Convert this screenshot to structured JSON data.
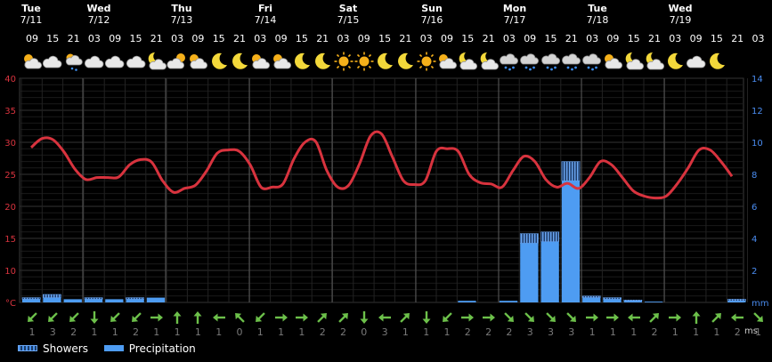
{
  "days": [
    {
      "name": "Tue",
      "date": "7/11"
    },
    {
      "name": "Wed",
      "date": "7/12"
    },
    {
      "name": "Thu",
      "date": "7/13"
    },
    {
      "name": "Fri",
      "date": "7/14"
    },
    {
      "name": "Sat",
      "date": "7/15"
    },
    {
      "name": "Sun",
      "date": "7/16"
    },
    {
      "name": "Mon",
      "date": "7/17"
    },
    {
      "name": "Tue",
      "date": "7/18"
    },
    {
      "name": "Wed",
      "date": "7/19"
    }
  ],
  "hours": [
    "09",
    "15",
    "21",
    "03",
    "09",
    "15",
    "21",
    "03",
    "09",
    "15",
    "21",
    "03",
    "09",
    "15",
    "21",
    "03",
    "09",
    "15",
    "21",
    "03",
    "09",
    "15",
    "21",
    "03",
    "09",
    "15",
    "21",
    "03",
    "09",
    "15",
    "21",
    "03",
    "09",
    "15",
    "21",
    "03",
    "09",
    "15"
  ],
  "icons": [
    "sun-cloud-icon",
    "cloud-icon",
    "cloud-rain-sun-icon",
    "cloud-icon",
    "cloud-icon",
    "cloud-icon",
    "moon-cloud-icon",
    "cloud-sun-icon",
    "sun-cloud-icon",
    "moon-icon",
    "moon-icon",
    "sun-cloud-icon",
    "sun-cloud-icon",
    "moon-icon",
    "moon-icon",
    "sun-icon",
    "sun-icon",
    "moon-icon",
    "moon-icon",
    "sun-icon",
    "sun-cloud-icon",
    "moon-cloud-icon",
    "moon-cloud-icon",
    "cloud-rain-icon",
    "cloud-rain-icon",
    "cloud-rain-icon",
    "cloud-rain-icon",
    "cloud-rain-icon",
    "sun-cloud-icon",
    "moon-cloud-icon",
    "moon-cloud-icon",
    "moon-icon",
    "cloud-icon",
    "moon-icon"
  ],
  "wind": {
    "directions": [
      "sw",
      "sw",
      "sw",
      "s",
      "sw",
      "sw",
      "e",
      "n",
      "n",
      "w",
      "nw",
      "sw",
      "e",
      "e",
      "ne",
      "ne",
      "s",
      "w",
      "ne",
      "s",
      "sw",
      "e",
      "e",
      "se",
      "se",
      "se",
      "se",
      "e",
      "e",
      "w",
      "ne",
      "e",
      "n",
      "ne",
      "w",
      "se"
    ],
    "speeds": [
      "1",
      "3",
      "2",
      "1",
      "1",
      "2",
      "1",
      "1",
      "1",
      "1",
      "0",
      "1",
      "1",
      "1",
      "2",
      "2",
      "0",
      "3",
      "1",
      "1",
      "1",
      "2",
      "2",
      "2",
      "3",
      "3",
      "3",
      "1",
      "1",
      "1",
      "2",
      "1",
      "1",
      "1",
      "2",
      "1"
    ],
    "unit": "ms"
  },
  "legend": {
    "showers": "Showers",
    "precipitation": "Precipitation"
  },
  "colors": {
    "temp_line": "#d8333e",
    "precip": "#4e9cf2",
    "wind_arrow": "#6cc04a",
    "grid": "#2a2a2a",
    "left_axis": "#d8333e",
    "right_axis": "#4a8cf0"
  },
  "chart_data": {
    "type": "line+bar",
    "left_axis": {
      "unit": "°C",
      "ticks": [
        "40",
        "35",
        "30",
        "25",
        "20",
        "15",
        "10",
        "°C"
      ],
      "ylim": [
        5,
        40
      ]
    },
    "right_axis": {
      "unit": "mm",
      "ticks": [
        "14",
        "12",
        "10",
        "8",
        "6",
        "4",
        "2",
        "mm"
      ],
      "ylim": [
        0,
        14
      ]
    },
    "temperature": [
      29.2,
      30.6,
      30.4,
      28.5,
      25.8,
      24.2,
      24.5,
      24.5,
      24.6,
      26.5,
      27.3,
      26.9,
      24.0,
      22.2,
      22.8,
      23.3,
      25.5,
      28.3,
      28.8,
      28.6,
      26.5,
      23.0,
      23.0,
      23.5,
      27.4,
      30.0,
      30.1,
      25.6,
      23.0,
      23.3,
      26.7,
      31.0,
      31.3,
      27.7,
      24.0,
      23.4,
      24.0,
      28.6,
      29.0,
      28.6,
      25.0,
      23.7,
      23.5,
      23.0,
      25.6,
      27.8,
      27.0,
      24.2,
      23.0,
      23.6,
      22.8,
      24.5,
      27.0,
      26.5,
      24.5,
      22.4,
      21.6,
      21.3,
      21.6,
      23.5,
      26.0,
      28.8,
      28.8,
      27.0,
      24.7
    ],
    "precipitation": [
      0.2,
      0.3,
      0.2,
      0.2,
      0.2,
      0.2,
      0.3,
      0,
      0,
      0,
      0,
      0,
      0,
      0,
      0,
      0,
      0,
      0,
      0,
      0,
      0,
      0.1,
      0,
      0.1,
      3.7,
      3.8,
      7.6,
      0.3,
      0.2,
      0.1,
      0.05,
      0,
      0,
      0,
      0.1,
      0
    ],
    "showers": [
      0.1,
      0.2,
      0,
      0.1,
      0,
      0.1,
      0,
      0,
      0,
      0,
      0,
      0,
      0,
      0,
      0,
      0,
      0,
      0,
      0,
      0,
      0,
      0,
      0,
      0,
      0.6,
      0.6,
      1.2,
      0.1,
      0.1,
      0.05,
      0,
      0,
      0,
      0,
      0.1,
      0
    ],
    "series": [
      {
        "name": "Showers"
      },
      {
        "name": "Precipitation"
      }
    ]
  }
}
